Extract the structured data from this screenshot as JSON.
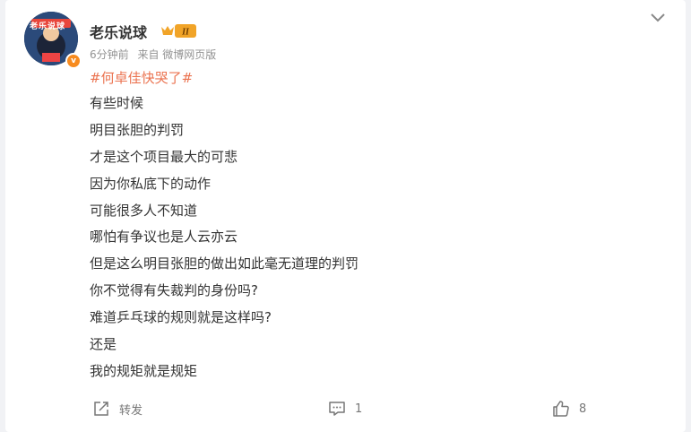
{
  "post": {
    "username": "老乐说球",
    "level_badge": "II",
    "verified_mark": "v",
    "avatar_text": "老乐说球",
    "time": "6分钟前",
    "source": "来自 微博网页版",
    "hashtag": "#何卓佳快哭了#",
    "lines": [
      "有些时候",
      "明目张胆的判罚",
      "才是这个项目最大的可悲",
      "因为你私底下的动作",
      "可能很多人不知道",
      "哪怕有争议也是人云亦云",
      "但是这么明目张胆的做出如此毫无道理的判罚",
      "你不觉得有失裁判的身份吗?",
      "难道乒乓球的规则就是这样吗?",
      "还是",
      "我的规矩就是规矩"
    ]
  },
  "actions": {
    "repost_label": "转发",
    "comment_count": "1",
    "like_count": "8"
  },
  "icons": {
    "more": "chevron-down-icon",
    "repost": "share-icon",
    "comment": "comment-icon",
    "like": "thumbs-up-icon"
  },
  "colors": {
    "hashtag": "#eb7350",
    "text": "#333333",
    "meta": "#939393",
    "badge": "#f78b1f"
  }
}
